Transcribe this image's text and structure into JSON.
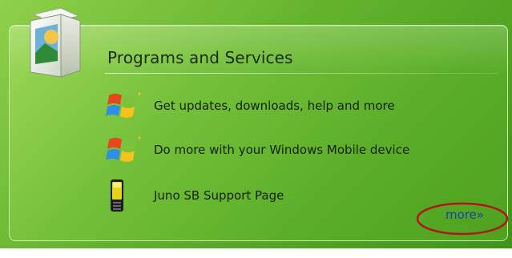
{
  "panel": {
    "title": "Programs and Services",
    "items": [
      {
        "label": "Get updates, downloads, help and more",
        "icon": "windows-flag-icon"
      },
      {
        "label": "Do more with your Windows Mobile device",
        "icon": "windows-flag-icon"
      },
      {
        "label": "Juno SB Support Page",
        "icon": "mobile-phone-icon"
      }
    ],
    "more_link": "more»"
  },
  "colors": {
    "panel_green": "#74c03a",
    "link_blue": "#1f3fb6",
    "annotation_red": "#b01818"
  }
}
